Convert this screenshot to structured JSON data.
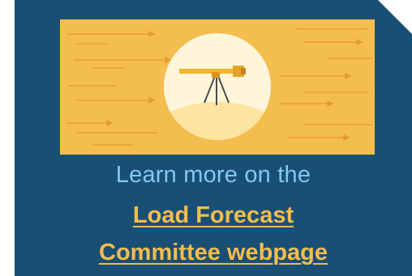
{
  "card": {
    "background_color": "#1a4f75",
    "caption": "Learn more on the",
    "link_line_1": "Load Forecast",
    "link_line_2": "Committee webpage",
    "caption_color": "#80c8ef",
    "link_color": "#f4bd4f"
  },
  "banner": {
    "icon": "telescope-icon",
    "background_color": "#f4bd4f",
    "circle_color": "#fff6da"
  }
}
